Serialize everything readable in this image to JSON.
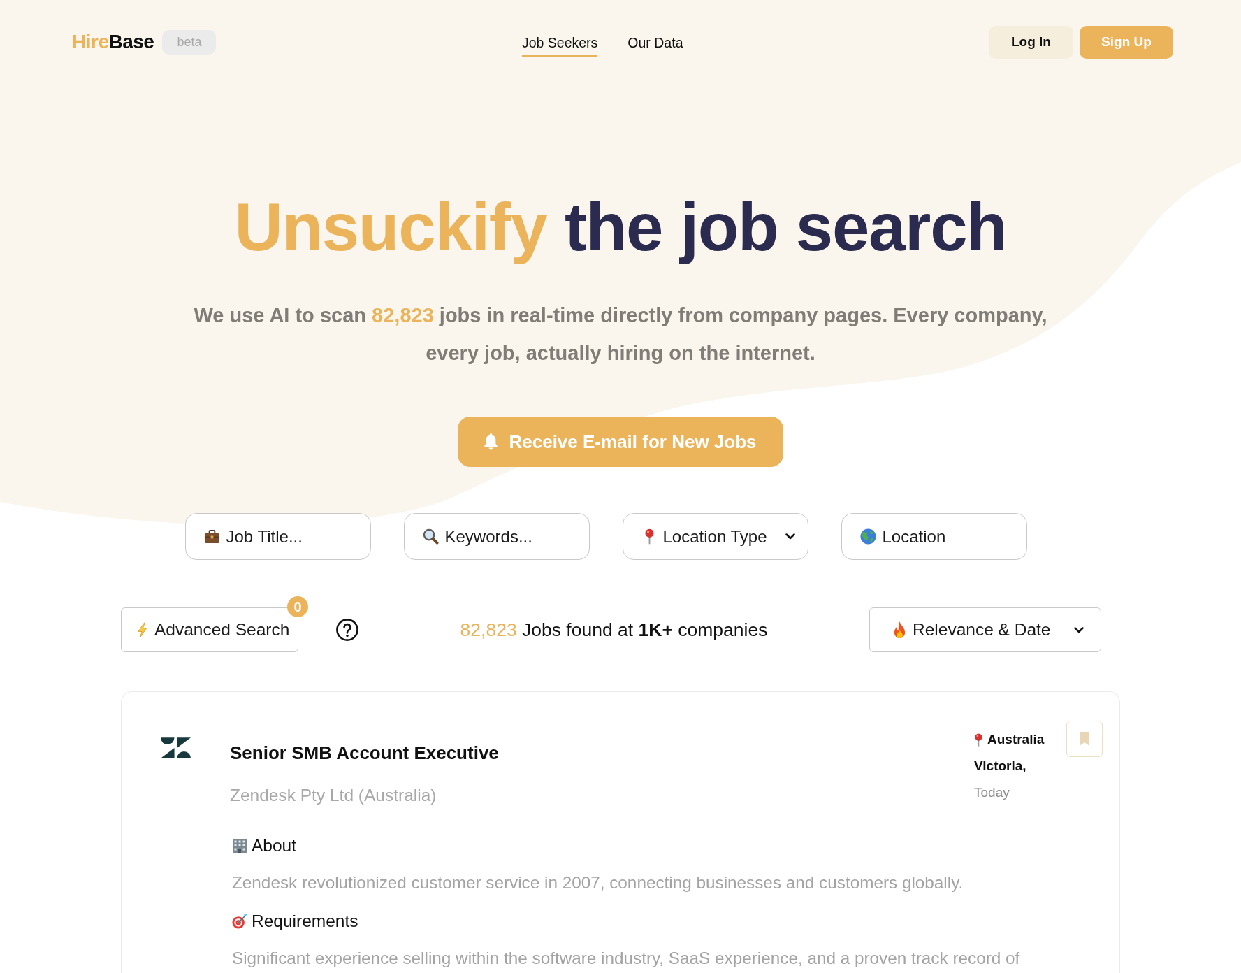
{
  "header": {
    "logo_primary": "Hire",
    "logo_secondary": "Base",
    "badge": "beta",
    "nav": [
      {
        "label": "Job Seekers",
        "selected": true
      },
      {
        "label": "Our Data",
        "selected": false
      }
    ],
    "login": "Log In",
    "signup": "Sign Up"
  },
  "hero": {
    "title_highlight": "Unsuckify",
    "title_rest": "the job search",
    "subtitle_before": "We use AI to scan",
    "job_count": "82,823",
    "subtitle_after": "jobs in real-time directly from company pages. Every company, every job, actually hiring on the internet.",
    "cta": "Receive E-mail for New Jobs"
  },
  "filters": {
    "job_title": {
      "placeholder": "Job Title..."
    },
    "keywords": {
      "placeholder": "Keywords..."
    },
    "location_type": {
      "label": "Location Type"
    },
    "location": {
      "placeholder": "Location"
    }
  },
  "toolbar": {
    "advanced_search": "Advanced Search",
    "filter_count": "0",
    "results_count": "82,823",
    "results_text": "Jobs found at **1K+** companies",
    "sort": "Relevance & Date"
  },
  "jobs": [
    {
      "title": "Senior SMB Account Executive",
      "company": "Zendesk Pty Ltd (Australia)",
      "location_country": "Australia",
      "location_region": "Victoria,",
      "posted": "Today",
      "saved": false,
      "sections": [
        {
          "kind": "about",
          "heading": "About",
          "text": "Zendesk revolutionized customer service in 2007, connecting businesses and customers globally."
        },
        {
          "kind": "requirements",
          "heading": "Requirements",
          "text": "Significant experience selling within the software industry, SaaS experience, and a proven track record of"
        }
      ]
    }
  ]
}
